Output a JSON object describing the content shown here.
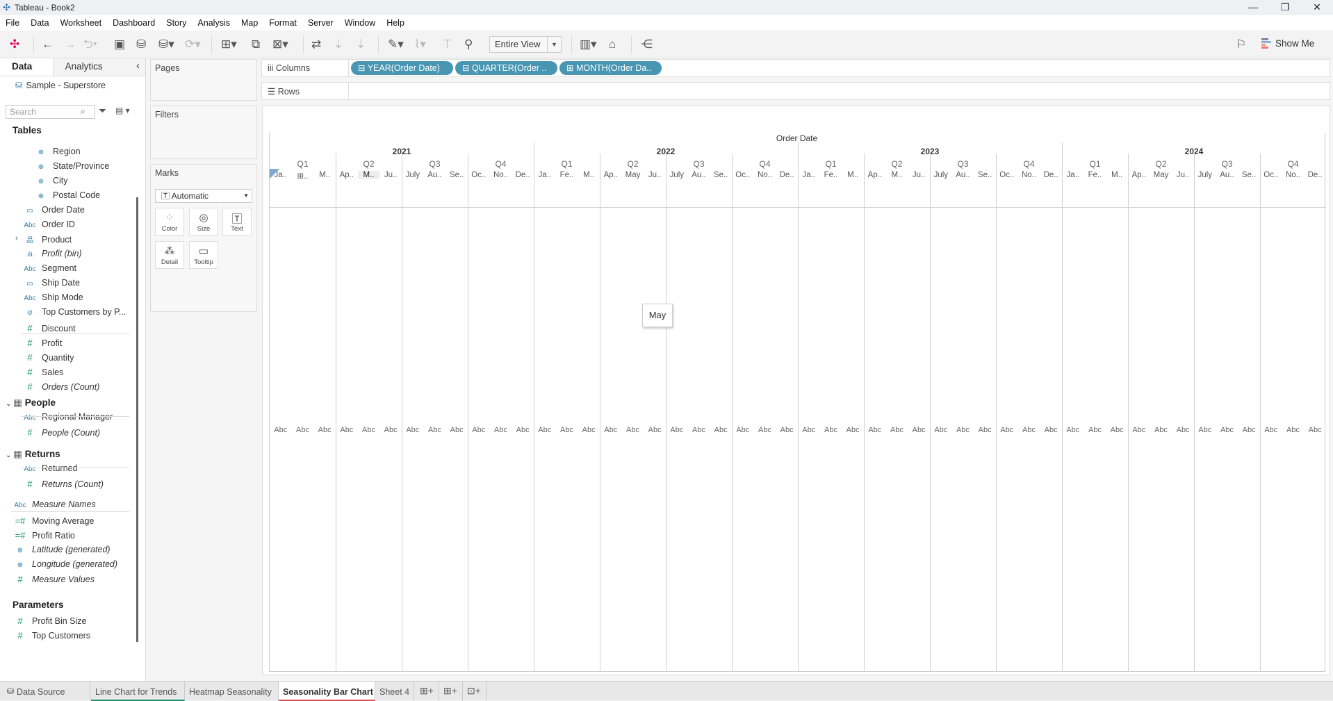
{
  "window": {
    "title": "Tableau - Book2",
    "minimize": "—",
    "restore": "❐",
    "close": "✕"
  },
  "menu": [
    "File",
    "Data",
    "Worksheet",
    "Dashboard",
    "Story",
    "Analysis",
    "Map",
    "Format",
    "Server",
    "Window",
    "Help"
  ],
  "toolbar": {
    "fit": "Entire View",
    "show_me": "Show Me"
  },
  "left": {
    "tab_data": "Data",
    "tab_analytics": "Analytics",
    "collapse": "‹",
    "datasource": "Sample - Superstore",
    "search_placeholder": "Search",
    "tables_heading": "Tables",
    "people_heading": "People",
    "returns_heading": "Returns",
    "parameters_heading": "Parameters",
    "orders_fields": [
      {
        "icon": "⊕",
        "label": "Region"
      },
      {
        "icon": "⊕",
        "label": "State/Province"
      },
      {
        "icon": "⊕",
        "label": "City"
      },
      {
        "icon": "⊕",
        "label": "Postal Code"
      },
      {
        "icon": "▭",
        "label": "Order Date"
      },
      {
        "icon": "Abc",
        "label": "Order ID"
      },
      {
        "icon": "品",
        "label": "Product"
      },
      {
        "icon": ".ılı.",
        "label": "Profit (bin)"
      },
      {
        "icon": "Abc",
        "label": "Segment"
      },
      {
        "icon": "▭",
        "label": "Ship Date"
      },
      {
        "icon": "Abc",
        "label": "Ship Mode"
      },
      {
        "icon": "⊘",
        "label": "Top Customers by P..."
      },
      {
        "icon": "#",
        "label": "Discount"
      },
      {
        "icon": "#",
        "label": "Profit"
      },
      {
        "icon": "#",
        "label": "Quantity"
      },
      {
        "icon": "#",
        "label": "Sales"
      },
      {
        "icon": "#",
        "label": "Orders (Count)"
      }
    ],
    "people_fields": [
      {
        "icon": "Abc",
        "label": "Regional Manager"
      },
      {
        "icon": "#",
        "label": "People (Count)"
      }
    ],
    "returns_fields": [
      {
        "icon": "Abc",
        "label": "Returned"
      },
      {
        "icon": "#",
        "label": "Returns (Count)"
      }
    ],
    "other_fields": [
      {
        "icon": "Abc",
        "label": "Measure Names"
      },
      {
        "icon": "=#",
        "label": "Moving Average"
      },
      {
        "icon": "=#",
        "label": "Profit Ratio"
      },
      {
        "icon": "⊕",
        "label": "Latitude (generated)"
      },
      {
        "icon": "⊕",
        "label": "Longitude (generated)"
      },
      {
        "icon": "#",
        "label": "Measure Values"
      }
    ],
    "parameters": [
      {
        "icon": "#",
        "label": "Profit Bin Size"
      },
      {
        "icon": "#",
        "label": "Top Customers"
      }
    ]
  },
  "cards": {
    "pages": "Pages",
    "filters": "Filters",
    "marks": "Marks",
    "mark_type": "Automatic",
    "color": "Color",
    "size": "Size",
    "text": "Text",
    "detail": "Detail",
    "tooltip": "Tooltip"
  },
  "shelves": {
    "columns": "Columns",
    "rows": "Rows",
    "column_pills": [
      "⊟ YEAR(Order Date)",
      "⊟ QUARTER(Order ..",
      "⊞ MONTH(Order Da.."
    ]
  },
  "view": {
    "header_title": "Order Date",
    "mark_text": "Abc",
    "tooltip": "May",
    "years": [
      "2021",
      "2022",
      "2023",
      "2024"
    ],
    "quarters": [
      "Q1",
      "Q2",
      "Q3",
      "Q4"
    ],
    "months": [
      [
        "Ja..",
        "⊞..",
        "M..",
        "Ap..",
        "M..",
        "Ju..",
        "July",
        "Au..",
        "Se..",
        "Oc..",
        "No..",
        "De.."
      ],
      [
        "Ja..",
        "Fe..",
        "M..",
        "Ap..",
        "May",
        "Ju..",
        "July",
        "Au..",
        "Se..",
        "Oc..",
        "No..",
        "De.."
      ],
      [
        "Ja..",
        "Fe..",
        "M..",
        "Ap..",
        "M..",
        "Ju..",
        "July",
        "Au..",
        "Se..",
        "Oc..",
        "No..",
        "De.."
      ],
      [
        "Ja..",
        "Fe..",
        "M..",
        "Ap..",
        "May",
        "Ju..",
        "July",
        "Au..",
        "Se..",
        "Oc..",
        "No..",
        "De.."
      ]
    ]
  },
  "sheet_tabs": {
    "data_source": "Data Source",
    "tabs": [
      "Line Chart for Trends",
      "Heatmap Seasonality",
      "Seasonality Bar Chart",
      "Sheet 4"
    ],
    "active": 2
  },
  "colors": {
    "pill": "#4996b2",
    "dimension": "#2f7eab",
    "measure": "#17936b",
    "active_tab": "#e0504f"
  }
}
